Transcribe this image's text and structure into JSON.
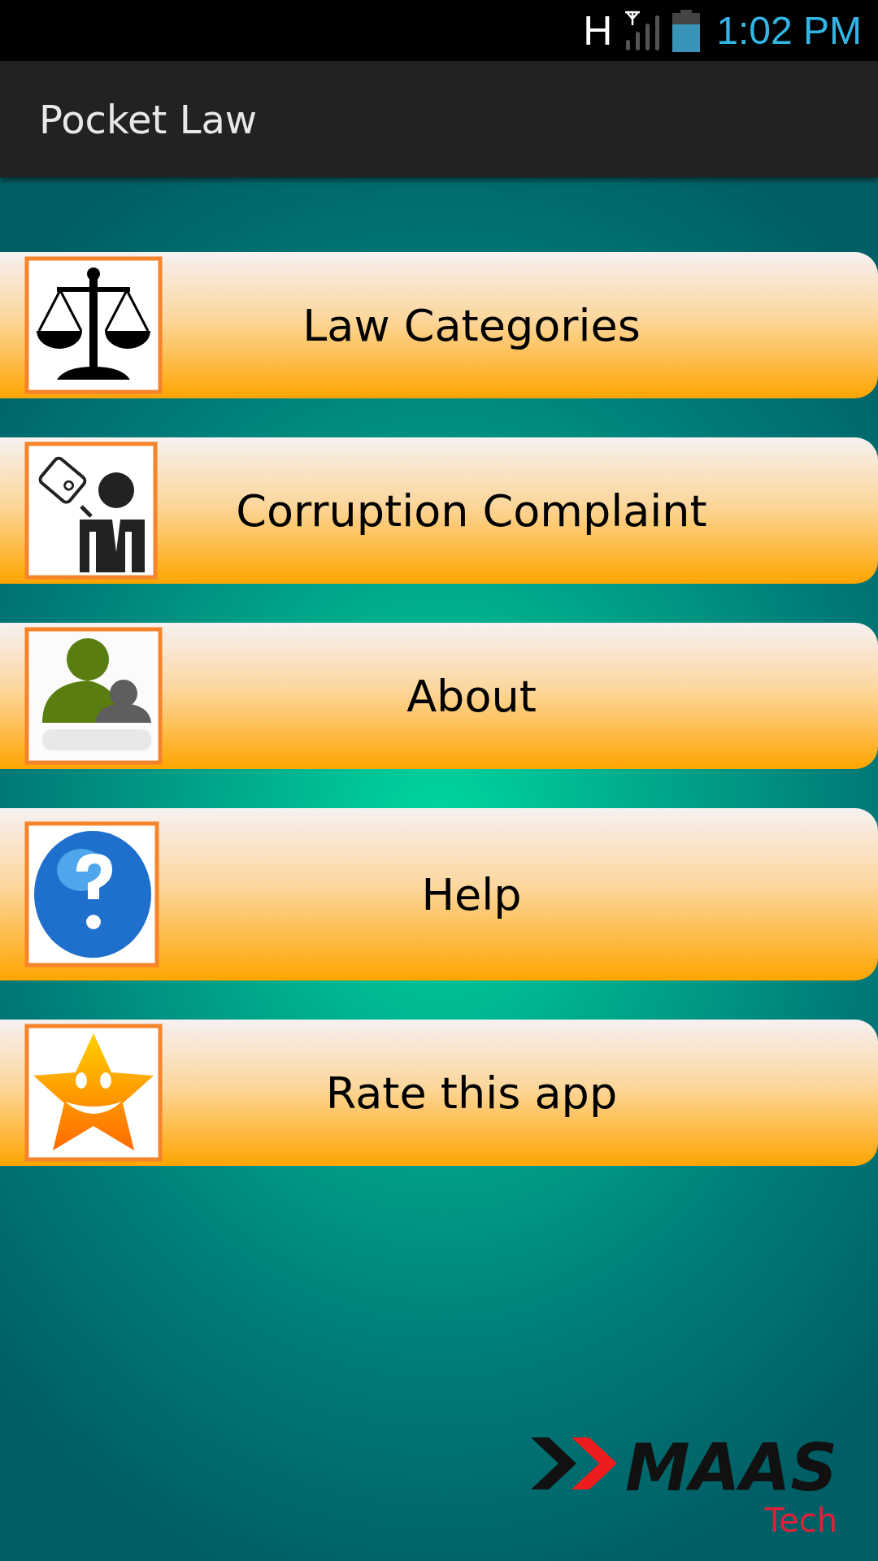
{
  "status_bar": {
    "network": "H",
    "time": "1:02 PM"
  },
  "app_bar": {
    "title": "Pocket Law"
  },
  "menu": [
    {
      "label": "Law Categories"
    },
    {
      "label": "Corruption Complaint"
    },
    {
      "label": "About"
    },
    {
      "label": "Help"
    },
    {
      "label": "Rate this app"
    }
  ],
  "logo": {
    "name": "MAAS",
    "sub": "Tech"
  }
}
